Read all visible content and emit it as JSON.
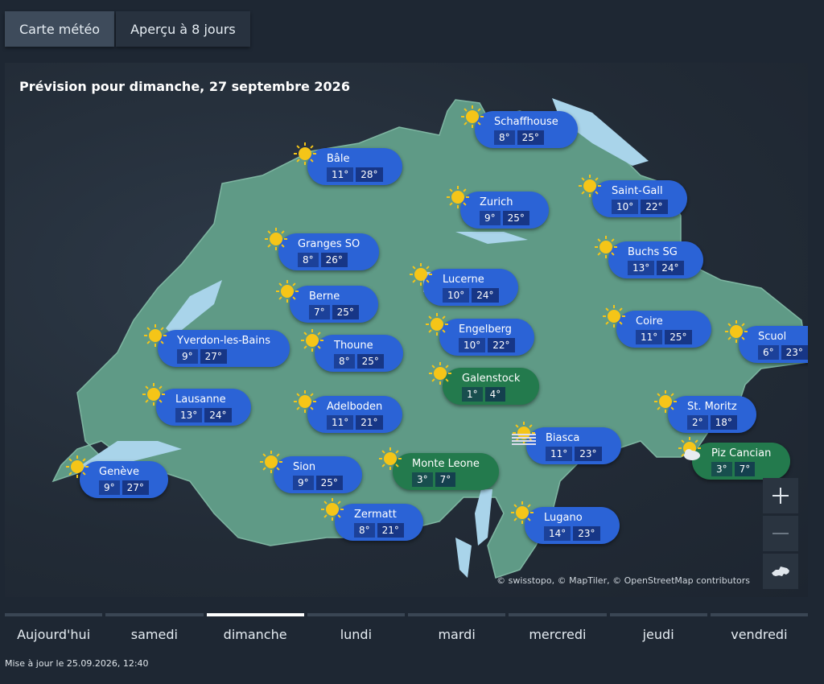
{
  "tabs": [
    "Carte météo",
    "Aperçu à 8 jours"
  ],
  "map": {
    "title": "Prévision pour dimanche, 27 septembre 2026",
    "attribution": "© swisstopo, © MapTiler, © OpenStreetMap contributors",
    "stations": [
      {
        "name": "Schaffhouse",
        "min": "8°",
        "max": "25°",
        "icon": "sun-icon"
      },
      {
        "name": "Bâle",
        "min": "11°",
        "max": "28°",
        "icon": "sun-icon"
      },
      {
        "name": "Zurich",
        "min": "9°",
        "max": "25°",
        "icon": "sun-icon"
      },
      {
        "name": "Saint-Gall",
        "min": "10°",
        "max": "22°",
        "icon": "sun-icon"
      },
      {
        "name": "Granges SO",
        "min": "8°",
        "max": "26°",
        "icon": "sun-icon"
      },
      {
        "name": "Buchs SG",
        "min": "13°",
        "max": "24°",
        "icon": "sun-icon"
      },
      {
        "name": "Lucerne",
        "min": "10°",
        "max": "24°",
        "icon": "sun-icon"
      },
      {
        "name": "Berne",
        "min": "7°",
        "max": "25°",
        "icon": "sun-icon"
      },
      {
        "name": "Coire",
        "min": "11°",
        "max": "25°",
        "icon": "sun-icon"
      },
      {
        "name": "Engelberg",
        "min": "10°",
        "max": "22°",
        "icon": "sun-icon"
      },
      {
        "name": "Yverdon-les-Bains",
        "min": "9°",
        "max": "27°",
        "icon": "sun-icon"
      },
      {
        "name": "Thoune",
        "min": "8°",
        "max": "25°",
        "icon": "sun-icon"
      },
      {
        "name": "Scuol",
        "min": "6°",
        "max": "23°",
        "icon": "sun-icon"
      },
      {
        "name": "Galenstock",
        "min": "1°",
        "max": "4°",
        "icon": "sun-icon"
      },
      {
        "name": "Lausanne",
        "min": "13°",
        "max": "24°",
        "icon": "sun-icon"
      },
      {
        "name": "Adelboden",
        "min": "11°",
        "max": "21°",
        "icon": "sun-icon"
      },
      {
        "name": "St. Moritz",
        "min": "2°",
        "max": "18°",
        "icon": "sun-icon"
      },
      {
        "name": "Biasca",
        "min": "11°",
        "max": "23°",
        "icon": "fog-sun-icon"
      },
      {
        "name": "Piz Cancian",
        "min": "3°",
        "max": "7°",
        "icon": "sun-cloud-icon"
      },
      {
        "name": "Genève",
        "min": "9°",
        "max": "27°",
        "icon": "sun-icon"
      },
      {
        "name": "Sion",
        "min": "9°",
        "max": "25°",
        "icon": "sun-icon"
      },
      {
        "name": "Monte Leone",
        "min": "3°",
        "max": "7°",
        "icon": "sun-icon"
      },
      {
        "name": "Zermatt",
        "min": "8°",
        "max": "21°",
        "icon": "sun-icon"
      },
      {
        "name": "Lugano",
        "min": "14°",
        "max": "23°",
        "icon": "sun-icon"
      }
    ]
  },
  "days": [
    "Aujourd'hui",
    "samedi",
    "dimanche",
    "lundi",
    "mardi",
    "mercredi",
    "jeudi",
    "vendredi"
  ],
  "selected_day": "dimanche",
  "updated": "Mise à jour le 25.09.2026, 12:40",
  "colors": {
    "pill_blue": "#2b63d6",
    "pill_green": "#237a4d",
    "land": "#5f9a86",
    "lake": "#a9d4ea",
    "sun": "#f5c518"
  }
}
